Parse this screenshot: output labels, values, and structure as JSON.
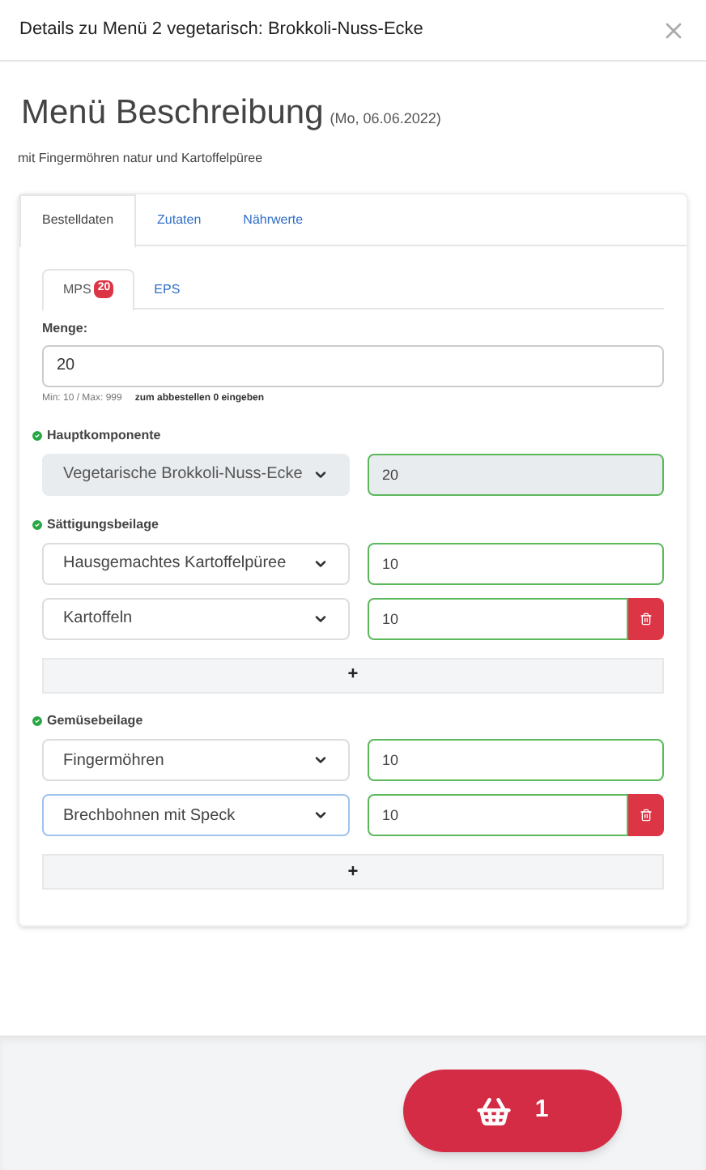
{
  "modal": {
    "title": "Details zu Menü 2 vegetarisch: Brokkoli-Nuss-Ecke"
  },
  "heading": {
    "title": "Menü Beschreibung",
    "date": "(Mo, 06.06.2022)",
    "subtitle": "mit Fingermöhren natur und Kartoffelpüree"
  },
  "tabs": [
    {
      "label": "Bestelldaten",
      "selected": true
    },
    {
      "label": "Zutaten",
      "selected": false
    },
    {
      "label": "Nährwerte",
      "selected": false
    }
  ],
  "subtabs": [
    {
      "label": "MPS",
      "badge": "20",
      "selected": true
    },
    {
      "label": "EPS",
      "selected": false
    }
  ],
  "quantity": {
    "label": "Menge:",
    "value": "20",
    "hint_range": "Min: 10 / Max: 999",
    "hint": "zum abbestellen 0 eingeben"
  },
  "sections": [
    {
      "title": "Hauptkomponente",
      "valid": true,
      "addable": false,
      "items": [
        {
          "option": "Vegetarische Brokkoli-Nuss-Ecke",
          "quantity": "20",
          "disabled": true,
          "removable": false,
          "focused": false
        }
      ]
    },
    {
      "title": "Sättigungsbeilage",
      "valid": true,
      "addable": true,
      "add_label": "+",
      "items": [
        {
          "option": "Hausgemachtes Kartoffelpüree",
          "quantity": "10",
          "disabled": false,
          "removable": false,
          "focused": false
        },
        {
          "option": "Kartoffeln",
          "quantity": "10",
          "disabled": false,
          "removable": true,
          "focused": false
        }
      ]
    },
    {
      "title": "Gemüsebeilage",
      "valid": true,
      "addable": true,
      "add_label": "+",
      "items": [
        {
          "option": "Fingermöhren",
          "quantity": "10",
          "disabled": false,
          "removable": false,
          "focused": false
        },
        {
          "option": "Brechbohnen mit Speck",
          "quantity": "10",
          "disabled": false,
          "removable": true,
          "focused": true
        }
      ]
    }
  ],
  "cart": {
    "count": "1"
  }
}
